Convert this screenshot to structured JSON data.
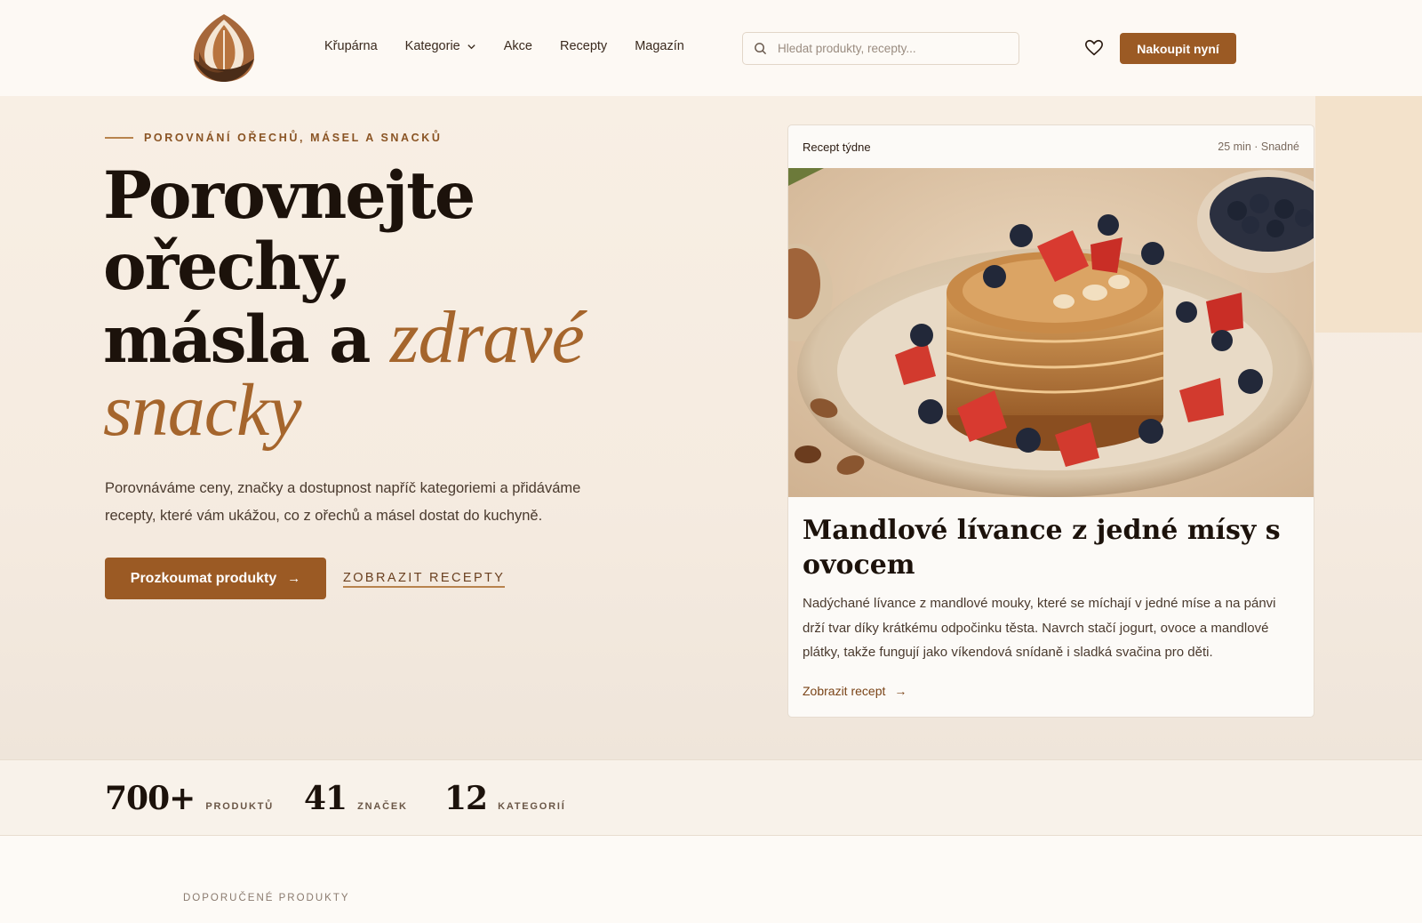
{
  "header": {
    "nav": [
      "Křupárna",
      "Kategorie",
      "Akce",
      "Recepty",
      "Magazín"
    ],
    "search_placeholder": "Hledat produkty, recepty...",
    "buy_label": "Nakoupit nyní"
  },
  "hero": {
    "eyebrow": "POROVNÁNÍ OŘECHŮ, MÁSEL A SNACKŮ",
    "title_line1": "Porovnejte",
    "title_line2": "ořechy,",
    "title_line3": "másla a ",
    "title_accent1": "zdravé",
    "title_accent2": "snacky",
    "text": "Porovnáváme ceny, značky a dostupnost napříč kategoriemi a přidáváme recepty, které vám ukážou, co z ořechů a másel dostat do kuchyně.",
    "cta_primary": "Prozkoumat produkty",
    "cta_secondary": "ZOBRAZIT RECEPTY"
  },
  "recipe_card": {
    "label": "Recept týdne",
    "meta": "25 min · Snadné",
    "title": "Mandlové lívance z jedné mísy s ovocem",
    "text": "Nadýchané lívance z mandlové mouky, které se míchají v jedné míse a na pánvi drží tvar díky krátkému odpočinku těsta. Navrch stačí jogurt, ovoce a mandlové plátky, takže fungují jako víkendová snídaně i sladká svačina pro děti.",
    "link": "Zobrazit recept"
  },
  "stats": [
    {
      "num": "700+",
      "label": "PRODUKTŮ"
    },
    {
      "num": "41",
      "label": "ZNAČEK"
    },
    {
      "num": "12",
      "label": "KATEGORIÍ"
    }
  ],
  "featured": {
    "eyebrow": "DOPORUČENÉ PRODUKTY"
  },
  "colors": {
    "accent": "#9b5a24",
    "accent_text": "#a5652c",
    "dark": "#1c120b"
  }
}
